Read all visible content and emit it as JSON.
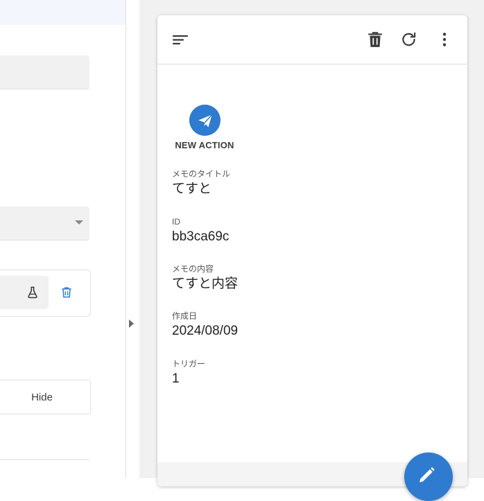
{
  "editor": {
    "hide_label": "Hide"
  },
  "app_bar": {
    "icons": [
      "menu-icon",
      "delete-icon",
      "refresh-icon",
      "more-vert-icon"
    ]
  },
  "action": {
    "icon": "send-icon",
    "label": "NEW ACTION"
  },
  "details": [
    {
      "label": "メモのタイトル",
      "value": "てすと"
    },
    {
      "label": "ID",
      "value": "bb3ca69c"
    },
    {
      "label": "メモの内容",
      "value": "てすと内容"
    },
    {
      "label": "作成日",
      "value": "2024/08/09"
    },
    {
      "label": "トリガー",
      "value": "1"
    }
  ],
  "fab": {
    "icon": "edit-icon"
  },
  "colors": {
    "accent": "#2e7bcf",
    "preview_background": "#f1f1f1",
    "field_background": "#f1f1f1"
  }
}
